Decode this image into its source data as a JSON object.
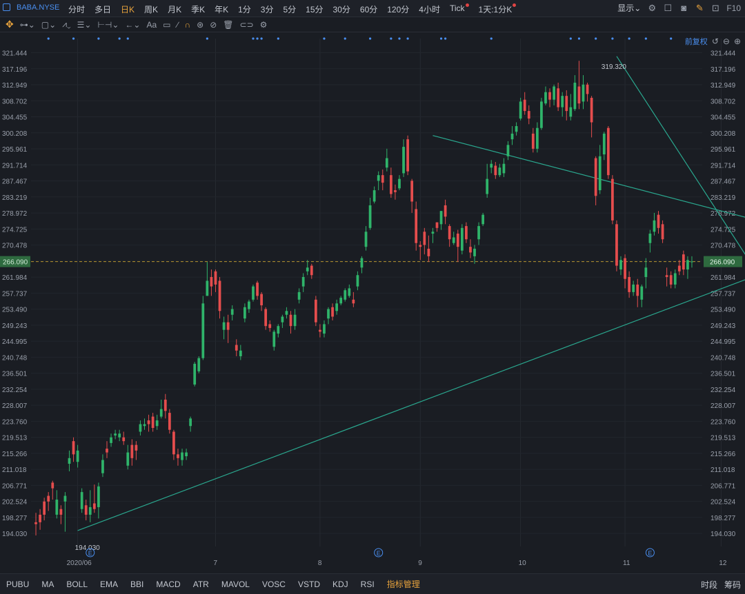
{
  "topbar": {
    "symbol": "BABA.NYSE",
    "tabs": [
      {
        "label": "分时",
        "active": false,
        "dot": false
      },
      {
        "label": "多日",
        "active": false,
        "dot": false
      },
      {
        "label": "日K",
        "active": true,
        "dot": false
      },
      {
        "label": "周K",
        "active": false,
        "dot": false
      },
      {
        "label": "月K",
        "active": false,
        "dot": false
      },
      {
        "label": "季K",
        "active": false,
        "dot": false
      },
      {
        "label": "年K",
        "active": false,
        "dot": false
      },
      {
        "label": "1分",
        "active": false,
        "dot": false
      },
      {
        "label": "3分",
        "active": false,
        "dot": false
      },
      {
        "label": "5分",
        "active": false,
        "dot": false
      },
      {
        "label": "15分",
        "active": false,
        "dot": false
      },
      {
        "label": "30分",
        "active": false,
        "dot": false
      },
      {
        "label": "60分",
        "active": false,
        "dot": false
      },
      {
        "label": "120分",
        "active": false,
        "dot": false
      },
      {
        "label": "4小时",
        "active": false,
        "dot": false
      },
      {
        "label": "Tick",
        "active": false,
        "dot": true
      },
      {
        "label": "1天:1分K",
        "active": false,
        "dot": true
      }
    ],
    "display_label": "显示",
    "f10_label": "F10"
  },
  "toolbar": {
    "aa_label": "Aa"
  },
  "chart_controls": {
    "adjust_label": "前复权"
  },
  "bottombar": {
    "indicators": [
      "PUBU",
      "MA",
      "BOLL",
      "EMA",
      "BBI",
      "MACD",
      "ATR",
      "MAVOL",
      "VOSC",
      "VSTD",
      "KDJ",
      "RSI"
    ],
    "manage_label": "指标管理",
    "right_items": [
      "时段",
      "筹码"
    ]
  },
  "colors": {
    "up": "#e54d4d",
    "down": "#2fb46a",
    "trend": "#2aa88f",
    "bg": "#1a1d23",
    "accent": "#e8a33d"
  },
  "chart_data": {
    "type": "candlestick",
    "title": "",
    "xlabel": "",
    "ylabel": "",
    "ylim": [
      191.5,
      323.0
    ],
    "y_ticks": [
      321.444,
      317.196,
      312.949,
      308.702,
      304.455,
      300.208,
      295.961,
      291.714,
      287.467,
      283.219,
      278.972,
      274.725,
      270.478,
      266.23,
      261.984,
      257.737,
      253.49,
      249.243,
      244.995,
      240.748,
      236.501,
      232.254,
      228.007,
      223.76,
      219.513,
      215.266,
      211.018,
      206.771,
      202.524,
      198.277,
      194.03
    ],
    "x_labels": [
      "2020/06",
      "7",
      "8",
      "9",
      "10",
      "11",
      "12"
    ],
    "x_label_index": [
      10,
      43,
      68,
      92,
      116,
      141,
      164
    ],
    "current_price": 266.09,
    "high_annotation": {
      "label": "319.320",
      "index": 136
    },
    "low_annotation": {
      "label": "194.030",
      "index": 10
    },
    "event_markers": {
      "label": "E",
      "index": [
        13,
        82,
        147
      ]
    },
    "dividend_dots": [
      3,
      9,
      15,
      20,
      22,
      41,
      52,
      53,
      54,
      58,
      69,
      74,
      80,
      85,
      87,
      89,
      97,
      98,
      109,
      128,
      130,
      134,
      138,
      142,
      146,
      152
    ],
    "trendlines": [
      {
        "from": [
          10,
          194.8
        ],
        "to": [
          171,
          261.8
        ]
      },
      {
        "from": [
          95,
          299.5
        ],
        "to": [
          171,
          277.5
        ]
      },
      {
        "from": [
          139,
          320.5
        ],
        "to": [
          173,
          262.5
        ]
      }
    ],
    "candles_ohlc": [
      [
        197.0,
        196.5,
        193.5,
        199.5
      ],
      [
        199.0,
        197.0,
        195.0,
        200.5
      ],
      [
        202.5,
        199.0,
        197.5,
        203.5
      ],
      [
        204.0,
        202.5,
        200.0,
        205.0
      ],
      [
        207.5,
        206.0,
        203.0,
        208.0
      ],
      [
        199.0,
        203.0,
        198.0,
        205.5
      ],
      [
        200.5,
        199.0,
        196.5,
        201.5
      ],
      [
        202.5,
        204.0,
        194.5,
        205.0
      ],
      [
        212.5,
        214.0,
        210.5,
        216.0
      ],
      [
        218.5,
        215.0,
        213.0,
        219.5
      ],
      [
        213.0,
        216.0,
        211.5,
        217.5
      ],
      [
        200.5,
        205.0,
        199.5,
        206.0
      ],
      [
        201.5,
        199.0,
        197.5,
        203.0
      ],
      [
        199.0,
        201.0,
        197.0,
        205.5
      ],
      [
        202.0,
        200.5,
        199.5,
        207.0
      ],
      [
        201.0,
        206.5,
        198.0,
        207.5
      ],
      [
        210.0,
        213.5,
        209.0,
        215.0
      ],
      [
        216.5,
        215.5,
        214.0,
        218.5
      ],
      [
        218.0,
        219.5,
        217.0,
        220.5
      ],
      [
        220.0,
        220.5,
        219.0,
        221.5
      ],
      [
        219.5,
        220.5,
        218.5,
        221.5
      ],
      [
        219.5,
        218.5,
        217.5,
        221.0
      ],
      [
        212.0,
        215.5,
        211.0,
        217.5
      ],
      [
        217.5,
        214.0,
        212.0,
        219.0
      ],
      [
        217.5,
        216.0,
        213.5,
        218.5
      ],
      [
        221.0,
        223.0,
        220.0,
        224.0
      ],
      [
        222.5,
        223.0,
        221.5,
        224.5
      ],
      [
        224.0,
        223.0,
        221.0,
        225.5
      ],
      [
        225.0,
        222.0,
        221.0,
        226.0
      ],
      [
        222.5,
        224.0,
        221.5,
        225.5
      ],
      [
        225.0,
        227.0,
        224.5,
        229.5
      ],
      [
        229.5,
        226.5,
        224.5,
        231.0
      ],
      [
        226.0,
        221.5,
        220.5,
        227.0
      ],
      [
        221.0,
        215.0,
        213.5,
        221.5
      ],
      [
        215.0,
        214.0,
        212.0,
        216.5
      ],
      [
        213.5,
        215.5,
        212.0,
        216.5
      ],
      [
        214.5,
        215.5,
        213.5,
        216.5
      ],
      [
        222.5,
        224.5,
        221.0,
        225.0
      ],
      [
        233.5,
        239.0,
        233.0,
        239.5
      ],
      [
        237.0,
        240.5,
        236.5,
        241.0
      ],
      [
        240.5,
        255.0,
        240.0,
        257.0
      ],
      [
        257.0,
        261.0,
        257.0,
        266.0
      ],
      [
        262.0,
        259.5,
        257.0,
        264.0
      ],
      [
        263.5,
        260.0,
        258.0,
        264.0
      ],
      [
        261.0,
        253.0,
        251.0,
        262.0
      ],
      [
        248.0,
        250.0,
        245.5,
        251.5
      ],
      [
        250.0,
        248.0,
        244.5,
        252.0
      ],
      [
        252.0,
        253.5,
        250.5,
        254.5
      ],
      [
        244.0,
        242.5,
        241.0,
        245.5
      ],
      [
        241.0,
        242.5,
        240.0,
        244.0
      ],
      [
        251.0,
        254.0,
        250.0,
        255.0
      ],
      [
        253.5,
        255.5,
        252.5,
        256.0
      ],
      [
        256.0,
        259.5,
        255.5,
        260.0
      ],
      [
        260.5,
        257.0,
        256.0,
        261.0
      ],
      [
        257.5,
        254.5,
        253.0,
        258.0
      ],
      [
        253.5,
        249.0,
        248.0,
        254.0
      ],
      [
        249.5,
        248.5,
        247.5,
        250.5
      ],
      [
        243.5,
        247.5,
        242.5,
        248.0
      ],
      [
        247.0,
        249.0,
        246.0,
        249.5
      ],
      [
        250.0,
        251.5,
        248.5,
        252.0
      ],
      [
        252.0,
        253.0,
        251.0,
        254.0
      ],
      [
        252.0,
        249.0,
        247.0,
        253.0
      ],
      [
        249.0,
        252.0,
        248.0,
        253.5
      ],
      [
        256.0,
        258.0,
        255.0,
        259.0
      ],
      [
        259.5,
        262.0,
        258.0,
        263.0
      ],
      [
        263.5,
        264.5,
        262.5,
        266.5
      ],
      [
        265.0,
        262.5,
        261.5,
        265.5
      ],
      [
        256.0,
        250.0,
        249.0,
        257.0
      ],
      [
        248.0,
        247.5,
        246.0,
        249.5
      ],
      [
        247.0,
        249.5,
        246.0,
        250.5
      ],
      [
        251.0,
        253.5,
        249.5,
        254.0
      ],
      [
        254.0,
        251.5,
        250.5,
        255.0
      ],
      [
        253.0,
        255.0,
        252.0,
        256.0
      ],
      [
        255.0,
        256.5,
        254.5,
        257.0
      ],
      [
        256.0,
        258.5,
        255.5,
        259.0
      ],
      [
        257.0,
        259.0,
        256.5,
        260.0
      ],
      [
        256.0,
        255.0,
        254.0,
        258.0
      ],
      [
        259.5,
        262.5,
        258.5,
        263.5
      ],
      [
        264.5,
        267.0,
        263.0,
        267.5
      ],
      [
        270.0,
        274.0,
        269.0,
        275.5
      ],
      [
        275.0,
        281.0,
        274.5,
        283.0
      ],
      [
        282.0,
        285.0,
        281.5,
        286.0
      ],
      [
        287.5,
        289.0,
        285.0,
        290.0
      ],
      [
        289.0,
        287.0,
        285.0,
        290.5
      ],
      [
        291.0,
        293.5,
        290.0,
        296.0
      ],
      [
        289.0,
        284.0,
        283.0,
        291.0
      ],
      [
        285.0,
        284.5,
        282.5,
        286.5
      ],
      [
        285.5,
        288.0,
        285.0,
        289.0
      ],
      [
        289.5,
        296.5,
        288.5,
        298.5
      ],
      [
        298.5,
        290.0,
        289.0,
        299.5
      ],
      [
        287.5,
        282.0,
        279.0,
        288.0
      ],
      [
        280.0,
        271.0,
        269.0,
        282.0
      ],
      [
        270.5,
        270.0,
        266.5,
        271.5
      ],
      [
        274.0,
        270.5,
        268.0,
        275.0
      ],
      [
        269.5,
        267.5,
        266.0,
        273.0
      ],
      [
        273.5,
        274.0,
        271.0,
        275.0
      ],
      [
        276.5,
        275.0,
        274.0,
        276.5
      ],
      [
        276.0,
        279.5,
        274.5,
        279.5
      ],
      [
        281.0,
        278.0,
        276.0,
        282.5
      ],
      [
        275.5,
        272.0,
        270.0,
        276.0
      ],
      [
        271.0,
        272.5,
        270.5,
        274.0
      ],
      [
        273.5,
        270.0,
        266.0,
        274.5
      ],
      [
        269.0,
        275.0,
        268.0,
        276.0
      ],
      [
        275.5,
        272.0,
        271.0,
        276.5
      ],
      [
        270.0,
        268.5,
        267.0,
        272.0
      ],
      [
        267.5,
        269.5,
        265.5,
        270.5
      ],
      [
        272.0,
        275.5,
        270.5,
        276.5
      ],
      [
        276.0,
        278.5,
        275.5,
        279.0
      ],
      [
        284.0,
        288.0,
        283.0,
        292.0
      ],
      [
        291.0,
        292.0,
        289.5,
        293.0
      ],
      [
        291.5,
        289.0,
        288.0,
        292.5
      ],
      [
        289.0,
        291.0,
        288.5,
        292.0
      ],
      [
        289.5,
        292.0,
        288.5,
        293.5
      ],
      [
        294.0,
        297.0,
        293.0,
        298.0
      ],
      [
        298.5,
        300.0,
        297.0,
        302.0
      ],
      [
        300.5,
        302.0,
        299.5,
        303.0
      ],
      [
        304.0,
        308.5,
        303.5,
        309.5
      ],
      [
        309.0,
        306.0,
        305.0,
        311.0
      ],
      [
        306.0,
        304.0,
        302.5,
        307.5
      ],
      [
        300.0,
        296.0,
        295.0,
        301.5
      ],
      [
        296.0,
        301.5,
        295.0,
        303.0
      ],
      [
        301.5,
        308.5,
        301.0,
        309.5
      ],
      [
        308.0,
        311.0,
        307.5,
        312.5
      ],
      [
        311.0,
        309.0,
        307.0,
        312.0
      ],
      [
        309.0,
        312.5,
        307.5,
        313.0
      ],
      [
        312.0,
        307.0,
        306.0,
        313.5
      ],
      [
        307.0,
        310.0,
        304.5,
        311.0
      ],
      [
        310.0,
        306.0,
        303.5,
        311.5
      ],
      [
        304.5,
        307.0,
        303.5,
        310.5
      ],
      [
        306.5,
        313.5,
        306.0,
        315.5
      ],
      [
        312.5,
        308.0,
        306.5,
        319.3
      ],
      [
        308.5,
        313.0,
        306.5,
        315.5
      ],
      [
        313.0,
        310.5,
        308.5,
        313.5
      ],
      [
        309.5,
        303.0,
        299.0,
        310.0
      ],
      [
        293.5,
        283.5,
        281.0,
        294.0
      ],
      [
        285.0,
        294.0,
        284.0,
        297.0
      ],
      [
        294.5,
        300.0,
        293.0,
        300.5
      ],
      [
        301.5,
        289.0,
        288.0,
        302.0
      ],
      [
        288.0,
        277.0,
        276.0,
        289.0
      ],
      [
        276.0,
        265.0,
        263.5,
        277.0
      ],
      [
        264.0,
        266.5,
        262.5,
        267.5
      ],
      [
        267.0,
        261.5,
        259.0,
        268.0
      ],
      [
        262.0,
        258.0,
        256.5,
        263.5
      ],
      [
        258.0,
        260.0,
        257.0,
        261.0
      ],
      [
        260.0,
        257.0,
        254.0,
        261.5
      ],
      [
        256.0,
        259.5,
        254.0,
        260.0
      ],
      [
        262.0,
        264.5,
        259.0,
        267.0
      ],
      [
        271.0,
        273.5,
        268.5,
        274.5
      ],
      [
        274.0,
        277.0,
        273.0,
        279.0
      ],
      [
        278.5,
        275.0,
        273.5,
        279.5
      ],
      [
        276.0,
        272.0,
        271.0,
        277.0
      ],
      [
        262.5,
        262.0,
        259.5,
        264.5
      ],
      [
        262.5,
        260.0,
        259.0,
        263.5
      ],
      [
        260.0,
        263.0,
        259.0,
        264.0
      ],
      [
        265.0,
        263.5,
        262.5,
        266.5
      ],
      [
        268.0,
        264.0,
        262.5,
        269.0
      ],
      [
        264.0,
        266.5,
        261.5,
        267.5
      ],
      [
        266.0,
        266.1,
        264.5,
        267.5
      ]
    ]
  }
}
